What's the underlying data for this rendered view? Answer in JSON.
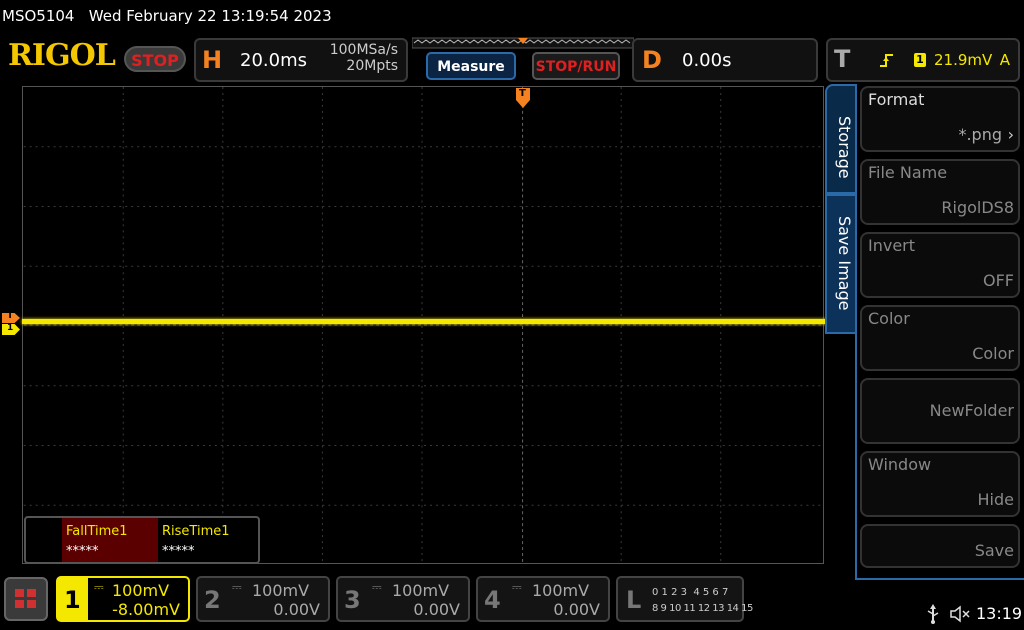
{
  "titlebar": {
    "model": "MSO5104",
    "datetime": "Wed February 22 13:19:54 2023"
  },
  "brand": {
    "logo": "RIGOL",
    "run_state": "STOP"
  },
  "horizontal": {
    "letter": "H",
    "timebase": "20.0ms",
    "sample_rate": "100MSa/s",
    "memory_depth": "20Mpts"
  },
  "toolbar": {
    "measure_label": "Measure",
    "stoprun_label": "STOP/RUN"
  },
  "delay": {
    "letter": "D",
    "value": "0.00s"
  },
  "trigger": {
    "letter": "T",
    "channel": "1",
    "level": "21.9mV",
    "mode": "A"
  },
  "markers": {
    "trigger_marker": "T",
    "trigger_side": "T",
    "channel_side": "1"
  },
  "side_tabs": {
    "storage": "Storage",
    "save_image": "Save Image"
  },
  "menu": [
    {
      "title": "Format",
      "value": "*.png"
    },
    {
      "title": "File Name",
      "value": "RigolDS8"
    },
    {
      "title": "Invert",
      "value": "OFF"
    },
    {
      "title": "Color",
      "value": "Color"
    },
    {
      "title": "",
      "value": "NewFolder"
    },
    {
      "title": "Window",
      "value": "Hide"
    },
    {
      "title": "",
      "value": "Save"
    }
  ],
  "measurements": {
    "fall_label": "FallTime1",
    "fall_value": "*****",
    "rise_label": "RiseTime1",
    "rise_value": "*****"
  },
  "channels": [
    {
      "num": "1",
      "scale": "100mV",
      "offset": "-8.00mV"
    },
    {
      "num": "2",
      "scale": "100mV",
      "offset": "0.00V"
    },
    {
      "num": "3",
      "scale": "100mV",
      "offset": "0.00V"
    },
    {
      "num": "4",
      "scale": "100mV",
      "offset": "0.00V"
    }
  ],
  "logic": {
    "letter": "L",
    "row1": "0 1 2 3  4 5 6 7",
    "row2": "8 9 10 11 12 13 14 15"
  },
  "status": {
    "time": "13:19"
  },
  "colors": {
    "ch1": "#f5e800",
    "accent": "#f58220",
    "stop": "#e02020",
    "menu_blue": "#2a6aa8"
  }
}
